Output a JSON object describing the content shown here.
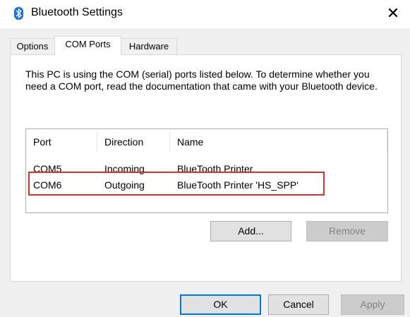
{
  "window": {
    "title": "Bluetooth Settings",
    "close_label": "✕"
  },
  "tabs": [
    {
      "label": "Options",
      "active": false
    },
    {
      "label": "COM Ports",
      "active": true
    },
    {
      "label": "Hardware",
      "active": false
    }
  ],
  "com_ports": {
    "description": "This PC is using the COM (serial) ports listed below. To determine whether you need a COM port, read the documentation that came with your Bluetooth device.",
    "columns": [
      "Port",
      "Direction",
      "Name"
    ],
    "rows": [
      {
        "port": "COM5",
        "direction": "Incoming",
        "name": "BlueTooth Printer"
      },
      {
        "port": "COM6",
        "direction": "Outgoing",
        "name": "BlueTooth Printer 'HS_SPP'"
      }
    ],
    "highlighted_row": "COM6",
    "highlight_color": "#d9312d",
    "add_label": "Add...",
    "remove_label": "Remove"
  },
  "footer": {
    "ok_label": "OK",
    "cancel_label": "Cancel",
    "apply_label": "Apply"
  },
  "icons": {
    "title_icon": "bluetooth-icon",
    "close_icon": "close-icon"
  },
  "colors": {
    "accent": "#0078d7",
    "bluetooth": "#1a6fd8"
  }
}
